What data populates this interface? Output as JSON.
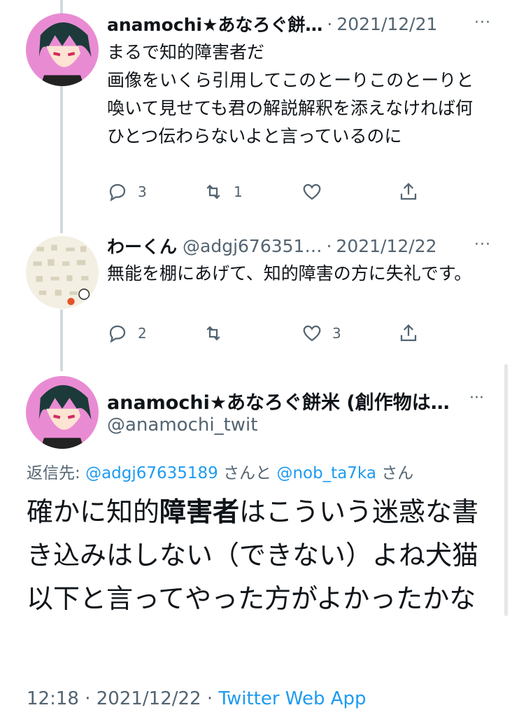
{
  "tweets": [
    {
      "name": "anamochi★あなろぐ餅…",
      "handle": "",
      "date": "2021/12/21",
      "text": "まるで知的障害者だ\n画像をいくら引用してこのとーりこのとーりと喚いて見せても君の解説解釈を添えなければ何ひとつ伝わらないよと言っているのに",
      "replies": "3",
      "retweets": "1",
      "likes": "",
      "avatar_icon": "anime-character-avatar"
    },
    {
      "name": "わーくん",
      "handle": "@adgj676351…",
      "date": "2021/12/22",
      "text": "無能を棚にあげて、知的障害の方に失礼です。",
      "replies": "2",
      "retweets": "",
      "likes": "3",
      "avatar_icon": "pattern-avatar"
    }
  ],
  "main_tweet": {
    "name": "anamochi★あなろぐ餅米 (創作物は…",
    "handle": "@anamochi_twit",
    "reply_prefix": "返信先: ",
    "mention1": "@adgj67635189",
    "reply_mid": " さんと ",
    "mention2": "@nob_ta7ka",
    "reply_suffix": " さん",
    "text_before": "確かに知的",
    "text_bold": "障害者",
    "text_after": "はこういう迷惑な書き込みはしない（できない）よね犬猫以下と言ってやった方がよかったかな",
    "time": "12:18",
    "sep": " · ",
    "date": "2021/12/22",
    "source": "Twitter Web App"
  },
  "more_label": "···",
  "colors": {
    "link": "#1d9bf0",
    "secondary": "#536471",
    "thread_line": "#cfd9de"
  }
}
